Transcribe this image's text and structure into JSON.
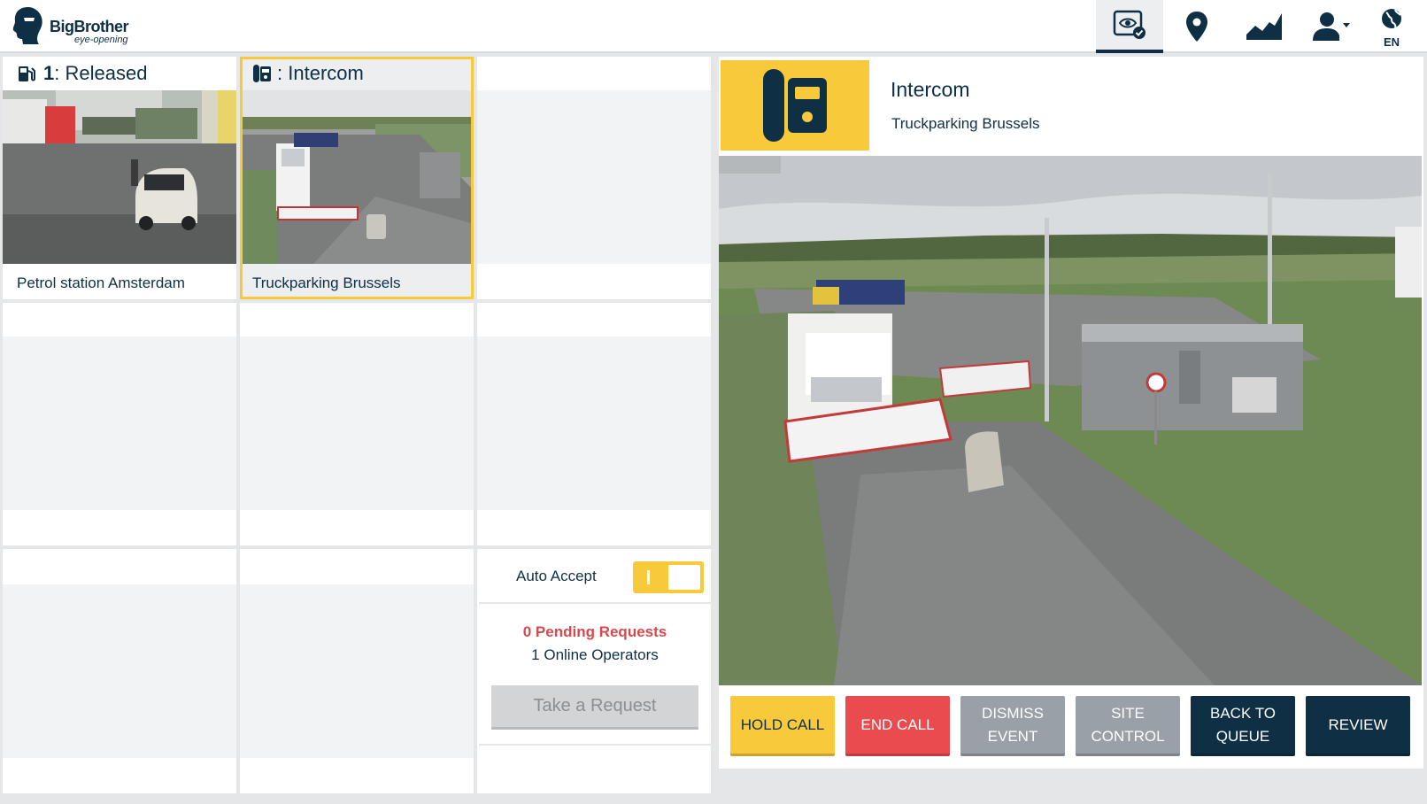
{
  "brand": {
    "name": "BigBrother",
    "tagline": "eye-opening"
  },
  "nav": {
    "items": [
      {
        "icon": "eye-check-icon",
        "active": true
      },
      {
        "icon": "location-pin-icon",
        "active": false
      },
      {
        "icon": "area-chart-icon",
        "active": false
      },
      {
        "icon": "user-dropdown-icon",
        "active": false
      }
    ],
    "language": "EN"
  },
  "tiles": [
    {
      "number": "1",
      "separator": ":",
      "status": "Released",
      "site": "Petrol station Amsterdam",
      "icon": "fuel-pump-icon",
      "selected": false
    },
    {
      "number": "",
      "separator": ":",
      "status": "Intercom",
      "site": "Truckparking Brussels",
      "icon": "intercom-icon",
      "selected": true
    }
  ],
  "queue": {
    "auto_accept_label": "Auto Accept",
    "auto_accept_on": true,
    "pending_requests": "0 Pending Requests",
    "online_operators": "1 Online Operators",
    "take_request_label": "Take a Request"
  },
  "call": {
    "type": "Intercom",
    "site": "Truckparking Brussels",
    "icon": "intercom-icon"
  },
  "actions": [
    {
      "label": "HOLD CALL",
      "style": "yellow"
    },
    {
      "label": "END CALL",
      "style": "red"
    },
    {
      "label": "DISMISS\nEVENT",
      "style": "gray"
    },
    {
      "label": "SITE\nCONTROL",
      "style": "gray"
    },
    {
      "label": "BACK TO\nQUEUE",
      "style": "navy"
    },
    {
      "label": "REVIEW",
      "style": "navy"
    }
  ],
  "colors": {
    "accent_yellow": "#f8c93a",
    "danger_red": "#ea4b4f",
    "neutral_gray": "#99a0a7",
    "navy": "#0e2f44",
    "pending_red": "#d9484c"
  }
}
